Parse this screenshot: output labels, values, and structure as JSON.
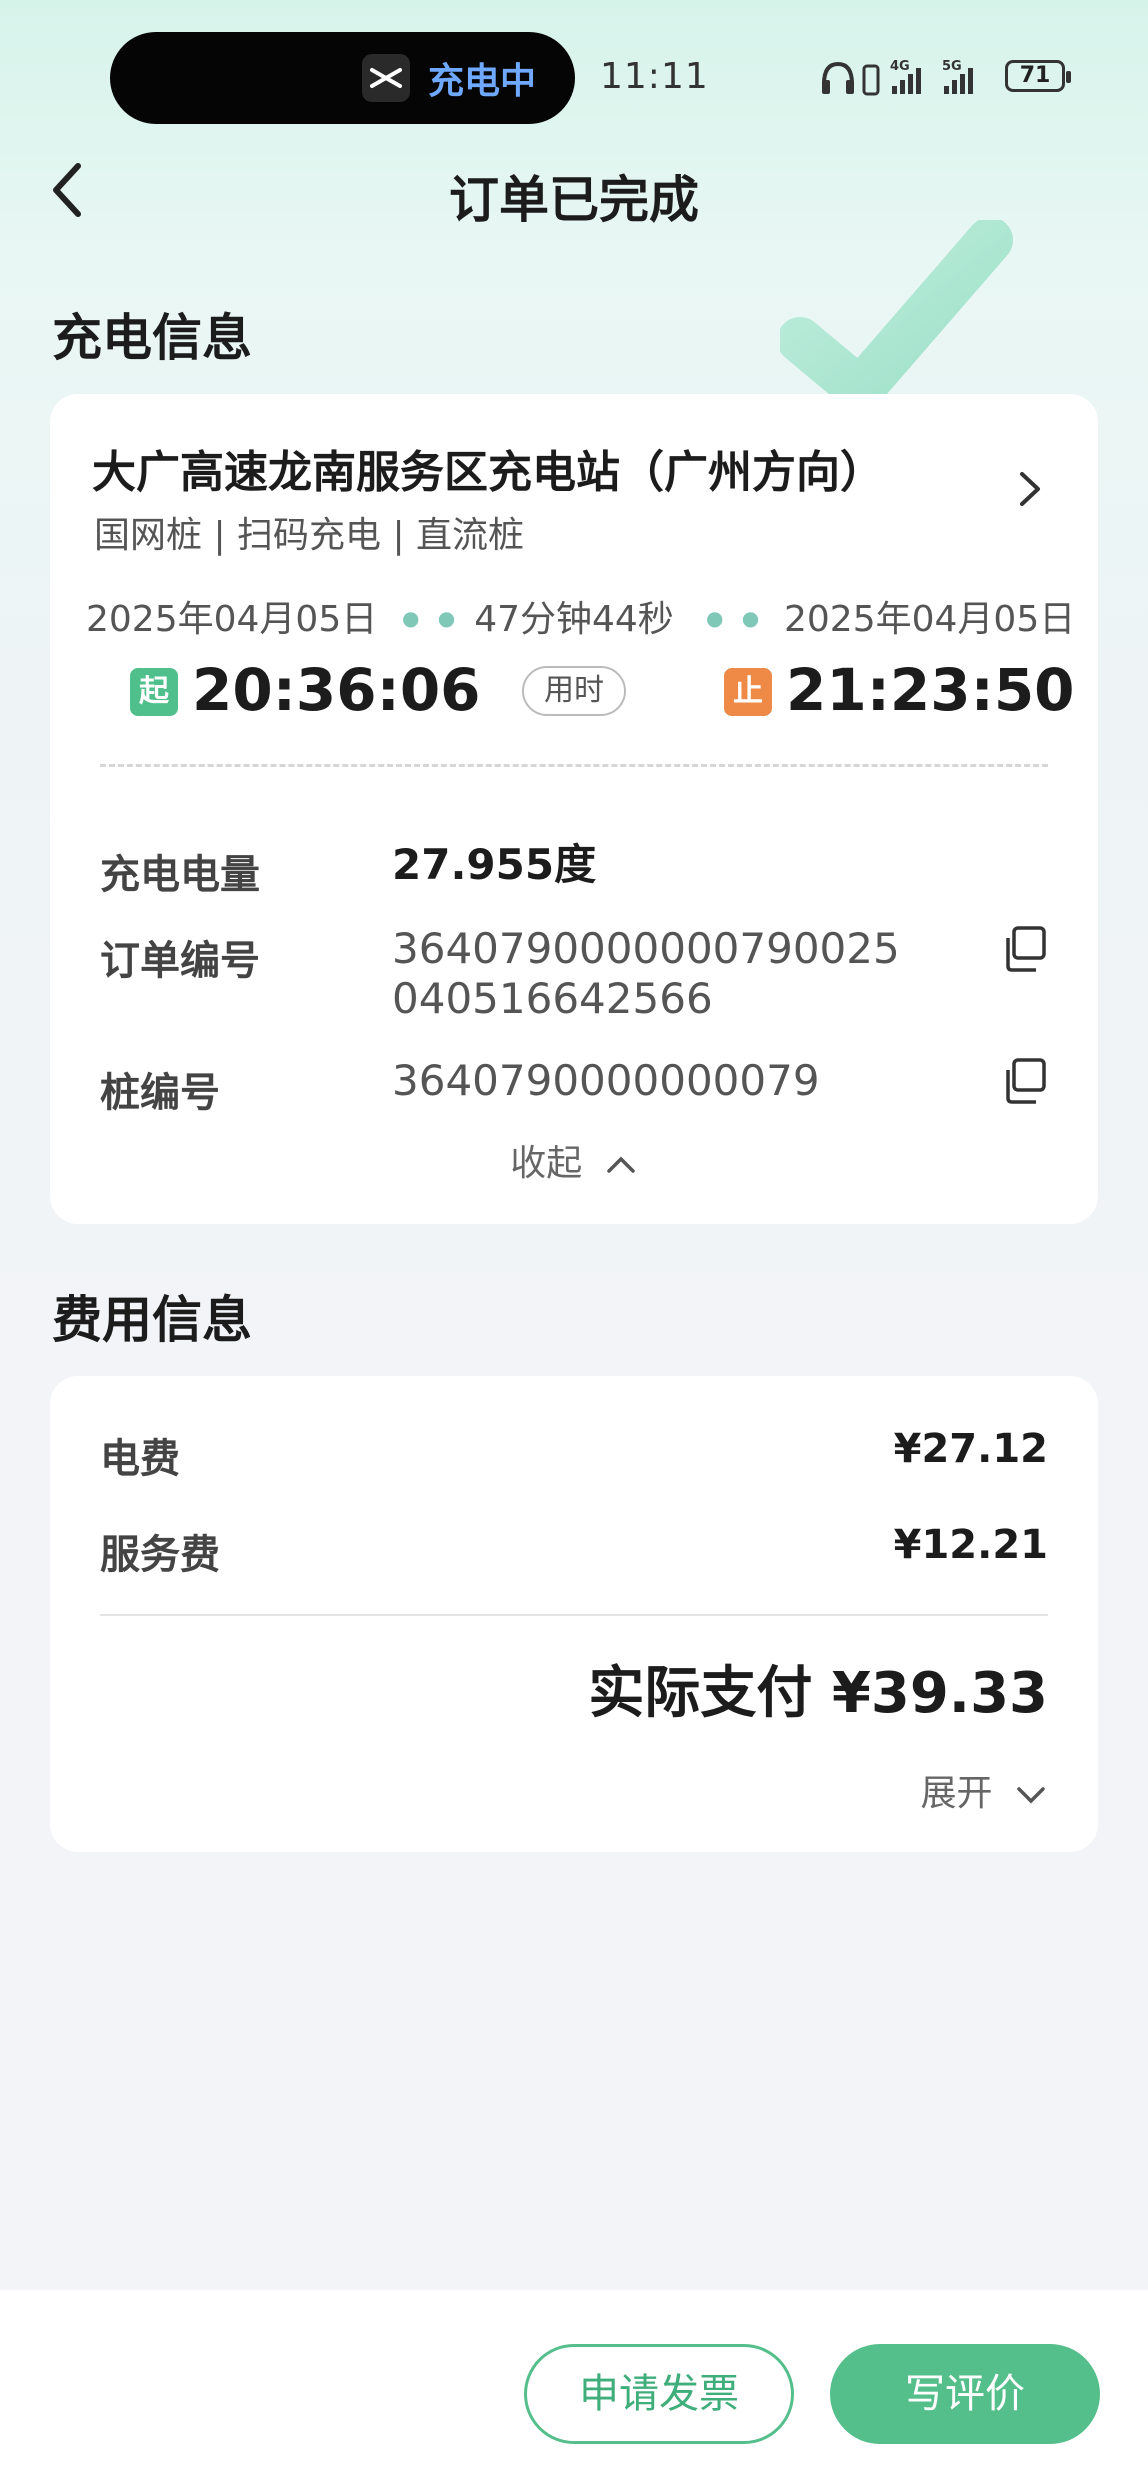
{
  "status_bar": {
    "pill_text": "充电中",
    "time": "11:11",
    "battery": "71",
    "network": [
      "4G",
      "5G"
    ]
  },
  "header": {
    "title": "订单已完成"
  },
  "charging_section": {
    "title": "充电信息",
    "station_name": "大广高速龙南服务区充电站（广州方向）",
    "station_tags": "国网桩 | 扫码充电 | 直流桩",
    "start_date": "2025年04月05日",
    "duration": "47分钟44秒",
    "end_date": "2025年04月05日",
    "start_badge": "起",
    "start_time": "20:36:06",
    "used_label": "用时",
    "stop_badge": "止",
    "end_time": "21:23:50",
    "energy_label": "充电电量",
    "energy_value": "27.955度",
    "order_label": "订单编号",
    "order_value_line1": "3640790000000790025",
    "order_value_line2": "040516642566",
    "pile_label": "桩编号",
    "pile_value": "3640790000000079",
    "collapse_label": "收起"
  },
  "fee_section": {
    "title": "费用信息",
    "electricity_label": "电费",
    "electricity_value": "¥27.12",
    "service_label": "服务费",
    "service_value": "¥12.21",
    "total_label": "实际支付 ¥39.33",
    "expand_label": "展开"
  },
  "bottom_bar": {
    "invoice_button": "申请发票",
    "review_button": "写评价"
  },
  "colors": {
    "accent_green": "#55bf8b",
    "start_badge": "#4fbf8c",
    "stop_badge": "#ef8a46",
    "pill_text": "#6fa8ff"
  }
}
